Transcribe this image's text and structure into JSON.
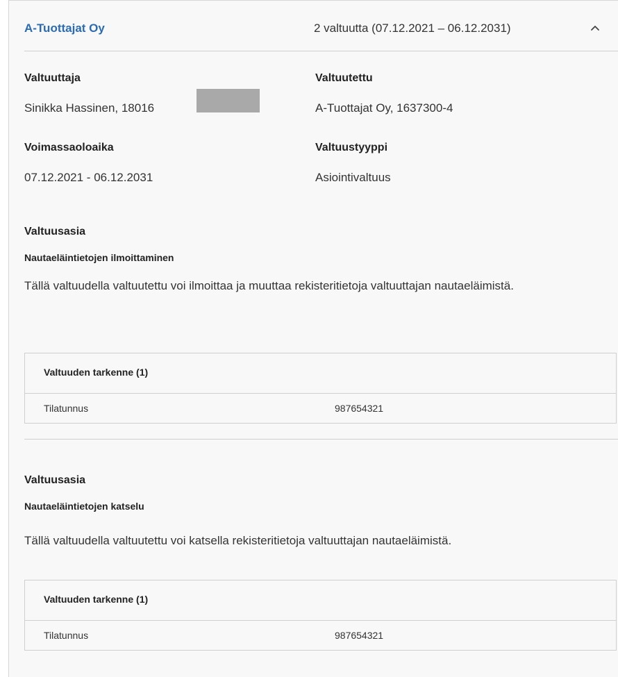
{
  "header": {
    "org_name": "A-Tuottajat Oy",
    "summary": "2 valtuutta (07.12.2021 – 06.12.2031)",
    "toggle_icon": "chevron-up-icon"
  },
  "details": {
    "principal_label": "Valtuuttaja",
    "principal_value": "Sinikka Hassinen, 18016",
    "agent_label": "Valtuutettu",
    "agent_value": "A-Tuottajat Oy, 1637300-4",
    "validity_label": "Voimassaoloaika",
    "validity_value": "07.12.2021 - 06.12.2031",
    "type_label": "Valtuustyyppi",
    "type_value": "Asiointivaltuus"
  },
  "mandates": [
    {
      "heading": "Valtuusasia",
      "title": "Nautaeläintietojen ilmoittaminen",
      "description": "Tällä valtuudella valtuutettu voi ilmoittaa ja muuttaa rekisteritietoja valtuuttajan nautaeläimistä.",
      "table_title": "Valtuuden tarkenne (1)",
      "row_key": "Tilatunnus",
      "row_value": "987654321"
    },
    {
      "heading": "Valtuusasia",
      "title": "Nautaeläintietojen katselu",
      "description": "Tällä valtuudella valtuutettu voi katsella rekisteritietoja valtuuttajan nautaeläimistä.",
      "table_title": "Valtuuden tarkenne (1)",
      "row_key": "Tilatunnus",
      "row_value": "987654321"
    }
  ],
  "colors": {
    "link_blue": "#2a6bb3",
    "panel_bg": "#f8f8f8",
    "divider": "#cfcfcf",
    "redaction": "#a9a9a9"
  }
}
